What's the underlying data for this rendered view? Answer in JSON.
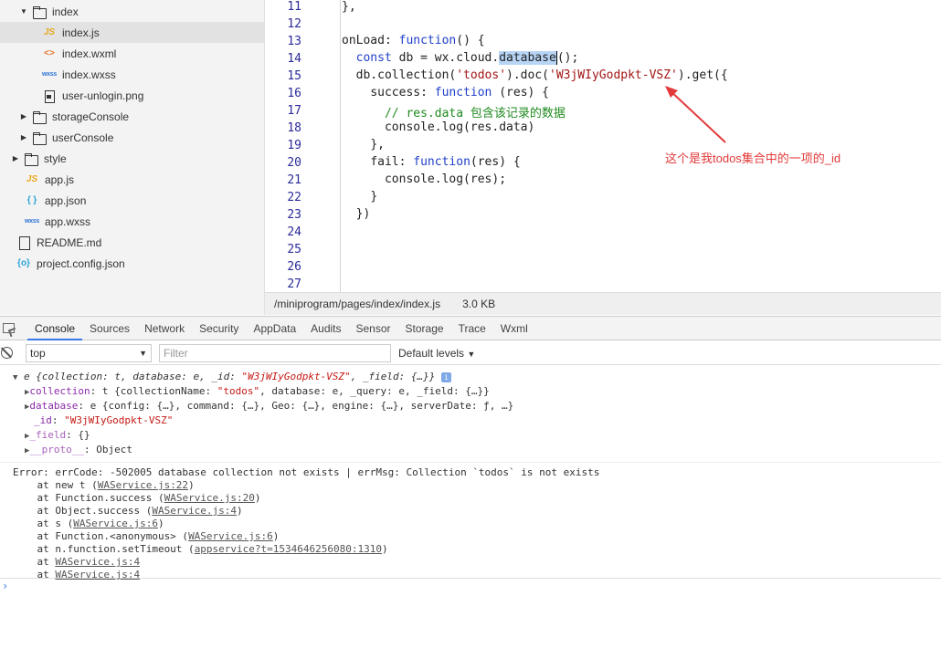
{
  "file_tree": [
    {
      "label": "index",
      "kind": "folder",
      "expanded": true,
      "indent": 1
    },
    {
      "label": "index.js",
      "kind": "js",
      "indent": 2,
      "selected": true
    },
    {
      "label": "index.wxml",
      "kind": "wxml",
      "indent": 2
    },
    {
      "label": "index.wxss",
      "kind": "wxss",
      "indent": 2
    },
    {
      "label": "user-unlogin.png",
      "kind": "png",
      "indent": 2
    },
    {
      "label": "storageConsole",
      "kind": "folder",
      "expanded": false,
      "indent": 1
    },
    {
      "label": "userConsole",
      "kind": "folder",
      "expanded": false,
      "indent": 1
    },
    {
      "label": "style",
      "kind": "folder",
      "expanded": false,
      "indent": 0
    },
    {
      "label": "app.js",
      "kind": "js",
      "indent": 1
    },
    {
      "label": "app.json",
      "kind": "json",
      "indent": 1
    },
    {
      "label": "app.wxss",
      "kind": "wxss",
      "indent": 1
    },
    {
      "label": "README.md",
      "kind": "md",
      "indent": 0
    },
    {
      "label": "project.config.json",
      "kind": "cfg",
      "indent": 0
    }
  ],
  "icons": {
    "js": "JS",
    "wxml": "<>",
    "wxss": "wxss",
    "json": "{ }",
    "cfg": "{o}",
    "expanded": "▼",
    "collapsed": "▶"
  },
  "editor": {
    "line_numbers": [
      "11",
      "12",
      "13",
      "14",
      "15",
      "16",
      "17",
      "18",
      "19",
      "20",
      "21",
      "22",
      "23",
      "24",
      "25",
      "26",
      "27"
    ],
    "code": {
      "l11": "},",
      "l13_name": "onLoad: ",
      "l13_kw": "function",
      "l13_rest": "() {",
      "l14_kw": "const",
      "l14_a": " db = wx.cloud.",
      "l14_sel": "database",
      "l14_b": "();",
      "l15_a": "db.collection(",
      "l15_s1": "'todos'",
      "l15_b": ").doc(",
      "l15_s2": "'W3jWIyGodpkt-VSZ'",
      "l15_c": ").get({",
      "l16_a": "success: ",
      "l16_kw": "function",
      "l16_b": " (res) {",
      "l17_cmt": "// res.data 包含该记录的数据",
      "l18": "console.log(res.data)",
      "l19": "},",
      "l20_a": "fail: ",
      "l20_kw": "function",
      "l20_b": "(res) {",
      "l21": "console.log(res);",
      "l22": "}",
      "l23": "})"
    },
    "annotation": "这个是我todos集合中的一项的_id",
    "annotation_color": "#e23a3a"
  },
  "statusbar": {
    "path": "/miniprogram/pages/index/index.js",
    "size": "3.0 KB"
  },
  "devtools": {
    "tabs": [
      "Console",
      "Sources",
      "Network",
      "Security",
      "AppData",
      "Audits",
      "Sensor",
      "Storage",
      "Trace",
      "Wxml"
    ],
    "active_tab": "Console",
    "context": "top",
    "filter_placeholder": "Filter",
    "levels": "Default levels"
  },
  "console": {
    "obj_head_a": "e {collection: t, database: e, _id: ",
    "obj_head_id": "\"W3jWIyGodpkt-VSZ\"",
    "obj_head_b": ", _field: {…}}",
    "collection_key": "collection",
    "collection_val_a": ": t {collectionName: ",
    "collection_val_s": "\"todos\"",
    "collection_val_b": ", database: e, _query: e, _field: {…}}",
    "database_key": "database",
    "database_val": ": e {config: {…}, command: {…}, Geo: {…}, engine: {…}, serverDate: ƒ, …}",
    "id_key": "_id",
    "id_val": "\"W3jWIyGodpkt-VSZ\"",
    "field_key": "_field",
    "field_val": ": {}",
    "proto_key": "__proto__",
    "proto_val": ": Object",
    "error_line": "Error: errCode: -502005 database collection not exists | errMsg: Collection `todos` is not exists",
    "stack": [
      {
        "prefix": "    at new t (",
        "link": "WAService.js:22",
        "suffix": ")"
      },
      {
        "prefix": "    at Function.success (",
        "link": "WAService.js:20",
        "suffix": ")"
      },
      {
        "prefix": "    at Object.success (",
        "link": "WAService.js:4",
        "suffix": ")"
      },
      {
        "prefix": "    at s (",
        "link": "WAService.js:6",
        "suffix": ")"
      },
      {
        "prefix": "    at Function.<anonymous> (",
        "link": "WAService.js:6",
        "suffix": ")"
      },
      {
        "prefix": "    at n.function.setTimeout (",
        "link": "appservice?t=1534646256080:1310",
        "suffix": ")"
      },
      {
        "prefix": "    at ",
        "link": "WAService.js:4",
        "suffix": ""
      },
      {
        "prefix": "    at ",
        "link": "WAService.js:4",
        "suffix": ""
      }
    ],
    "prompt": "›"
  }
}
